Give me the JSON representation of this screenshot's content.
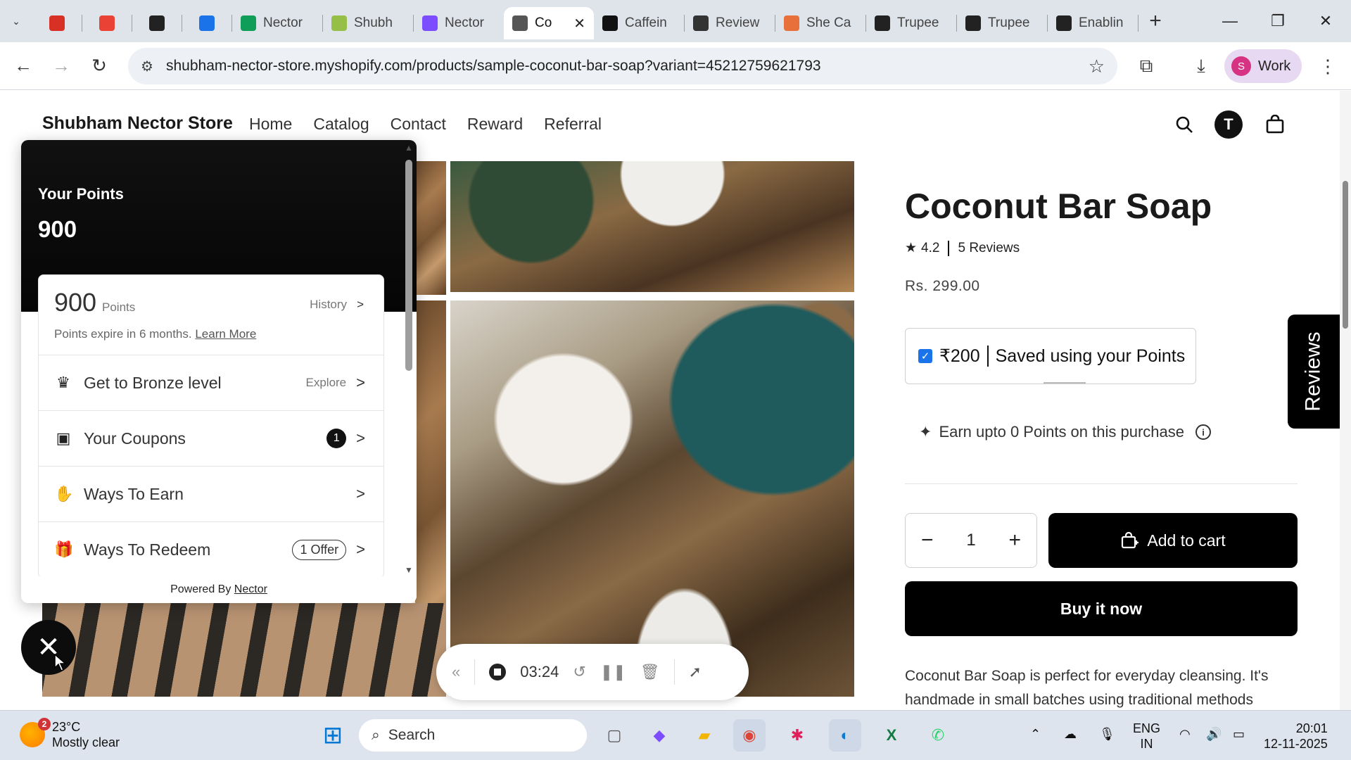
{
  "browser": {
    "tabs": [
      {
        "label": "",
        "icon": "record-icon",
        "color": "#d93025",
        "pinned": true
      },
      {
        "label": "",
        "icon": "gmail-icon",
        "color": "#ea4335",
        "pinned": true
      },
      {
        "label": "",
        "icon": "chatgpt-icon",
        "color": "#222222",
        "pinned": true
      },
      {
        "label": "",
        "icon": "calendar-icon",
        "color": "#1a73e8",
        "pinned": true
      },
      {
        "label": "Nector",
        "icon": "sheets-icon",
        "color": "#0f9d58"
      },
      {
        "label": "Shubh",
        "icon": "shopify-icon",
        "color": "#95bf47"
      },
      {
        "label": "Nector",
        "icon": "nector-icon",
        "color": "#7b4dff"
      },
      {
        "label": "Co",
        "icon": "globe-icon",
        "color": "#555555",
        "active": true
      },
      {
        "label": "Caffein",
        "icon": "app-icon",
        "color": "#111111"
      },
      {
        "label": "Review",
        "icon": "review-icon",
        "color": "#333333"
      },
      {
        "label": "She Ca",
        "icon": "flame-icon",
        "color": "#e8703a"
      },
      {
        "label": "Trupee",
        "icon": "doc-icon",
        "color": "#222222"
      },
      {
        "label": "Trupee",
        "icon": "doc-icon",
        "color": "#222222"
      },
      {
        "label": "Enablin",
        "icon": "doc-icon",
        "color": "#222222"
      }
    ],
    "url": "shubham-nector-store.myshopify.com/products/sample-coconut-bar-soap?variant=45212759621793",
    "profile_initial": "S",
    "profile_label": "Work"
  },
  "store": {
    "name": "Shubham Nector Store",
    "nav": [
      "Home",
      "Catalog",
      "Contact",
      "Reward",
      "Referral"
    ],
    "avatar_initial": "T"
  },
  "product": {
    "title": "Coconut Bar Soap",
    "rating": "4.2",
    "reviews": "5 Reviews",
    "price": "Rs. 299.00",
    "points_saved_amount": "₹200",
    "points_saved_text": "Saved using your Points",
    "earn_text": "Earn upto 0 Points on this purchase",
    "quantity": "1",
    "add_to_cart": "Add to cart",
    "buy_now": "Buy it now",
    "description": "Coconut Bar Soap is perfect for everyday cleansing. It's handmade in small batches using traditional methods",
    "reviews_tab": "Reviews"
  },
  "widget": {
    "header_label": "Your Points",
    "header_points": "900",
    "card_points": "900",
    "card_unit": "Points",
    "history": "History",
    "expire_text": "Points expire in 6 months.",
    "learn_more": "Learn More",
    "rows": [
      {
        "label": "Get to Bronze level",
        "right": "Explore",
        "icon": "crown-icon"
      },
      {
        "label": "Your Coupons",
        "badge": "1",
        "icon": "coupon-icon"
      },
      {
        "label": "Ways To Earn",
        "icon": "earn-hand-icon"
      },
      {
        "label": "Ways To Redeem",
        "offer": "1 Offer",
        "icon": "gift-icon"
      }
    ],
    "powered_by": "Powered By",
    "powered_brand": "Nector"
  },
  "recorder": {
    "time": "03:24"
  },
  "taskbar": {
    "weather_badge": "2",
    "temperature": "23°C",
    "condition": "Mostly clear",
    "search": "Search",
    "lang_top": "ENG",
    "lang_bottom": "IN",
    "time": "20:01",
    "date": "12-11-2025"
  }
}
